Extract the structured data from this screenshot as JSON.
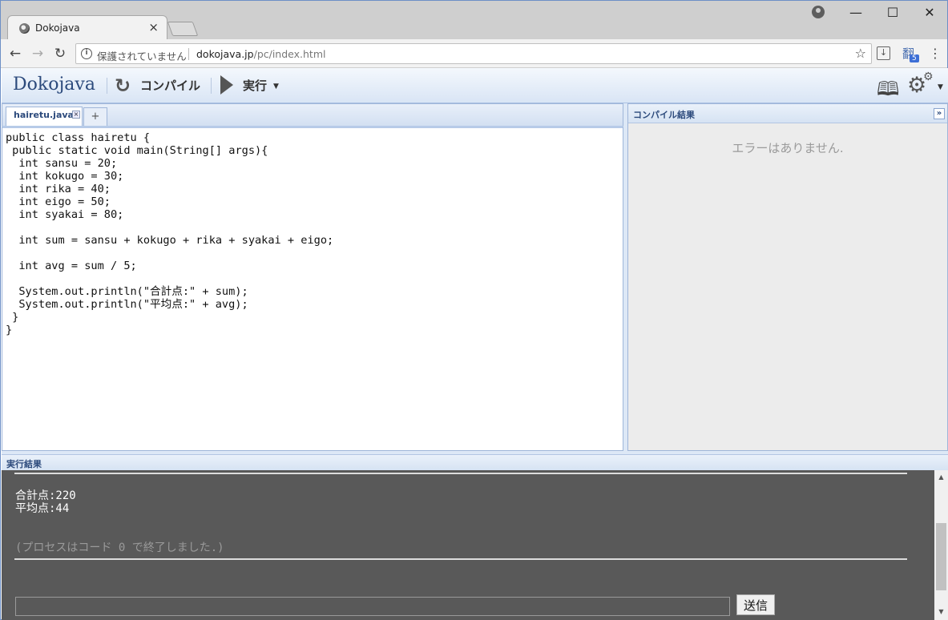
{
  "browser": {
    "tab_title": "Dokojava",
    "tab_close": "×",
    "security_label": "保護されていません",
    "url_host": "dokojava.jp",
    "url_path": "/pc/index.html",
    "window_controls": {
      "minimize": "—",
      "maximize": "☐",
      "close": "✕"
    },
    "nav": {
      "back": "←",
      "forward": "→",
      "reload": "↻"
    },
    "extension_badge": "5"
  },
  "app": {
    "logo": "Dokojava",
    "compile_label": "コンパイル",
    "run_label": "実行",
    "file_tab": "hairetu.java",
    "add_tab": "+",
    "code": "public class hairetu {\n public static void main(String[] args){\n  int sansu = 20;\n  int kokugo = 30;\n  int rika = 40;\n  int eigo = 50;\n  int syakai = 80;\n\n  int sum = sansu + kokugo + rika + syakai + eigo;\n\n  int avg = sum / 5;\n\n  System.out.println(\"合計点:\" + sum);\n  System.out.println(\"平均点:\" + avg);\n }\n}",
    "compile_panel": {
      "title": "コンパイル結果",
      "message": "エラーはありません."
    },
    "run_panel": {
      "title": "実行結果",
      "output": "合計点:220\n平均点:44",
      "status": "(プロセスはコード 0 で終了しました.)",
      "input_value": "",
      "send_label": "送信"
    }
  }
}
